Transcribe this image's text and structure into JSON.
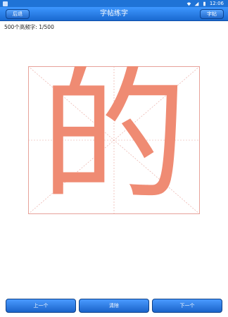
{
  "status_bar": {
    "time": "12:06"
  },
  "app_bar": {
    "title": "字帖练字",
    "back_label": "后退",
    "copybook_label": "字帖"
  },
  "counter": {
    "text": "500个高频字: 1/500"
  },
  "practice": {
    "character": "的",
    "character_color": "#ef8b73",
    "grid_color": "#e7a29a"
  },
  "buttons": {
    "prev_label": "上一个",
    "clear_label": "清除",
    "next_label": "下一个"
  },
  "colors": {
    "accent": "#1f73d6"
  }
}
